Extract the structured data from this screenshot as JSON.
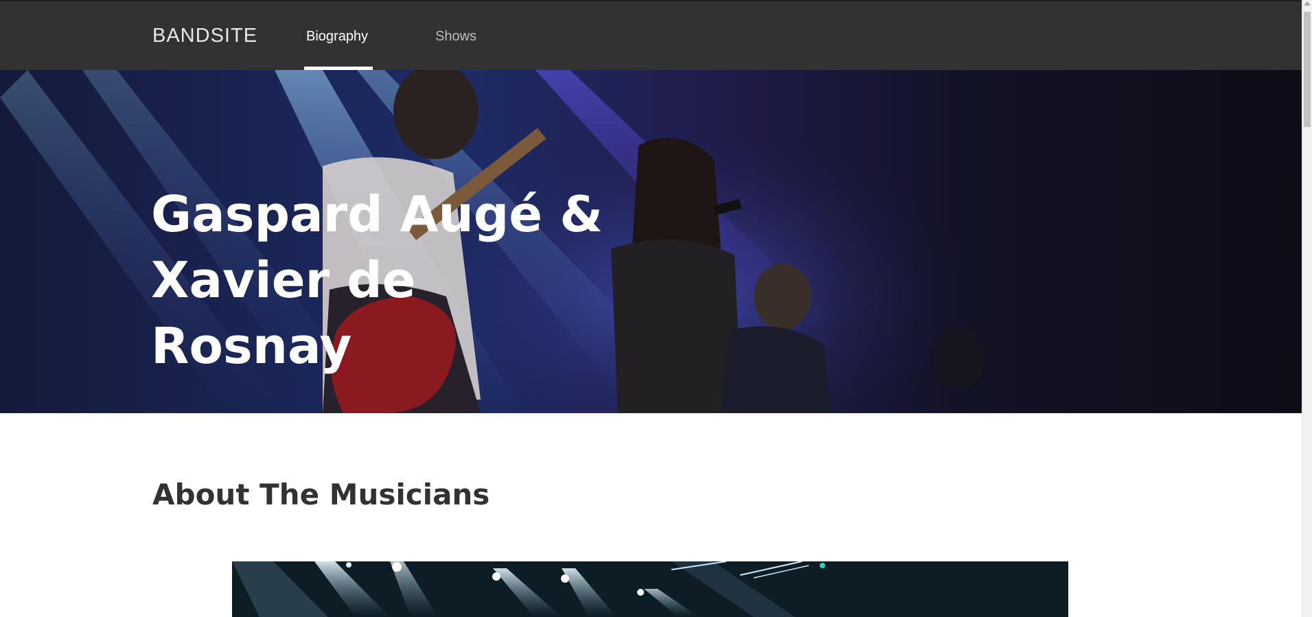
{
  "header": {
    "logo": "BANDSITE",
    "nav": [
      {
        "label": "Biography",
        "active": true
      },
      {
        "label": "Shows",
        "active": false
      }
    ]
  },
  "hero": {
    "title_line1": "Gaspard Augé &",
    "title_line2": "Xavier de Rosnay"
  },
  "about": {
    "heading": "About The Musicians"
  },
  "colors": {
    "header_bg": "#323232",
    "text_dark": "#323232",
    "nav_active": "#ffffff",
    "nav_inactive": "#bdbdbd"
  }
}
